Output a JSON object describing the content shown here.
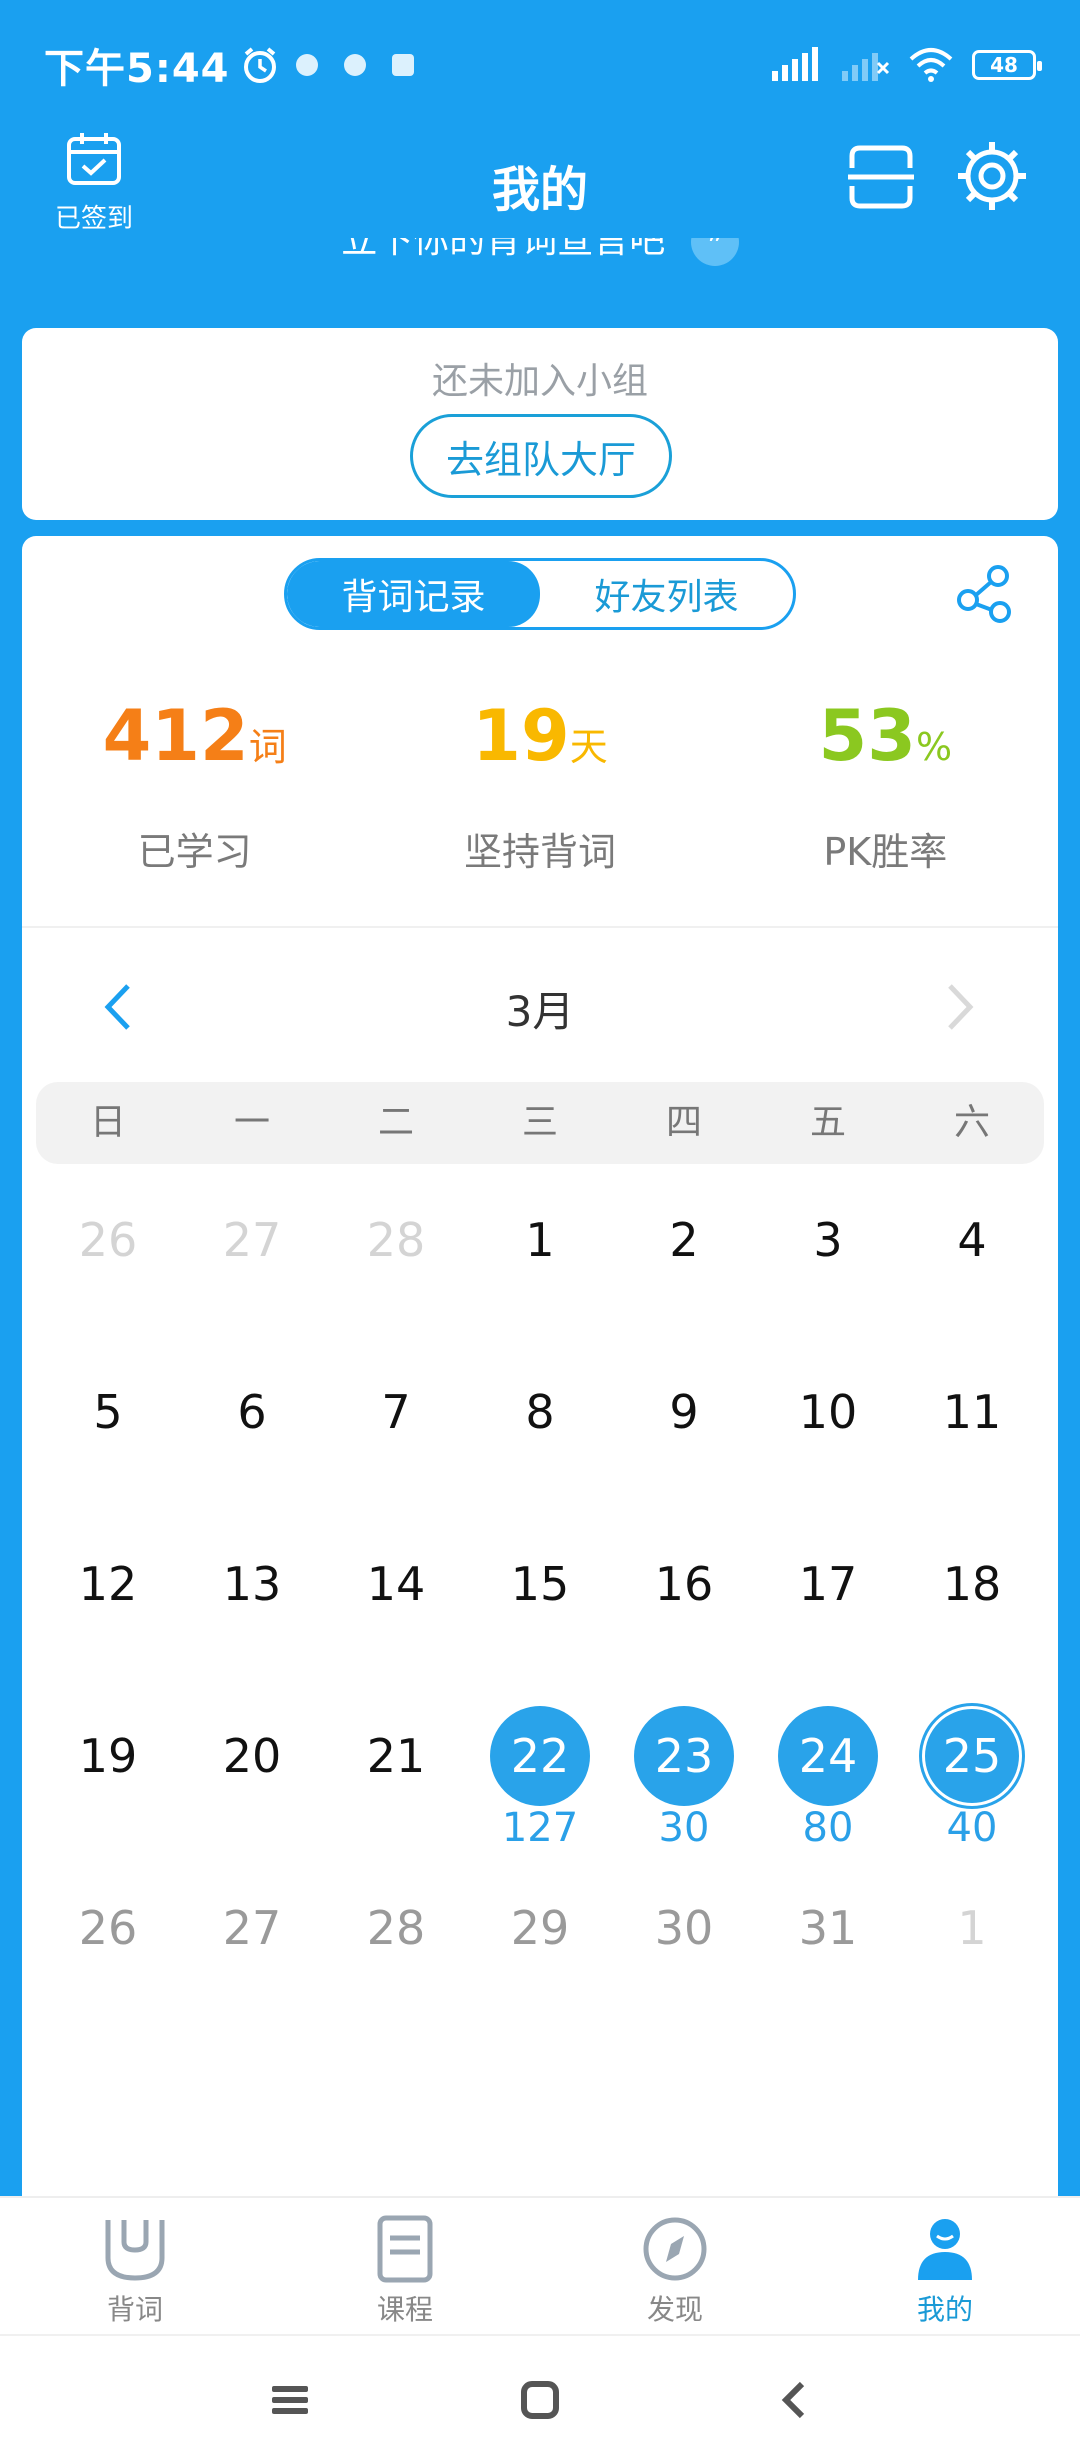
{
  "status_bar": {
    "time": "下午5:44",
    "battery": "48"
  },
  "header": {
    "title": "我的",
    "checkin_label": "已签到"
  },
  "slogan": "立下你的背词宣言吧",
  "group": {
    "status_text": "还未加入小组",
    "team_button": "去组队大厅"
  },
  "tabs": [
    {
      "label": "背词记录",
      "active": true
    },
    {
      "label": "好友列表",
      "active": false
    }
  ],
  "stats": [
    {
      "value": "412",
      "unit": "词",
      "label": "已学习",
      "color": "#f57f17"
    },
    {
      "value": "19",
      "unit": "天",
      "label": "坚持背词",
      "color": "#f9b800"
    },
    {
      "value": "53",
      "unit": "%",
      "label": "PK胜率",
      "color": "#8bc820"
    }
  ],
  "calendar": {
    "month": "3月",
    "weekdays": [
      "日",
      "一",
      "二",
      "三",
      "四",
      "五",
      "六"
    ],
    "weeks": [
      [
        {
          "d": "26",
          "s": "light"
        },
        {
          "d": "27",
          "s": "light"
        },
        {
          "d": "28",
          "s": "light"
        },
        {
          "d": "1"
        },
        {
          "d": "2"
        },
        {
          "d": "3"
        },
        {
          "d": "4"
        }
      ],
      [
        {
          "d": "5"
        },
        {
          "d": "6"
        },
        {
          "d": "7"
        },
        {
          "d": "8"
        },
        {
          "d": "9"
        },
        {
          "d": "10"
        },
        {
          "d": "11"
        }
      ],
      [
        {
          "d": "12"
        },
        {
          "d": "13"
        },
        {
          "d": "14"
        },
        {
          "d": "15"
        },
        {
          "d": "16"
        },
        {
          "d": "17"
        },
        {
          "d": "18"
        }
      ],
      [
        {
          "d": "19"
        },
        {
          "d": "20"
        },
        {
          "d": "21"
        },
        {
          "d": "22",
          "m": true,
          "c": "127"
        },
        {
          "d": "23",
          "m": true,
          "c": "30"
        },
        {
          "d": "24",
          "m": true,
          "c": "80"
        },
        {
          "d": "25",
          "m": true,
          "c": "40",
          "today": true
        }
      ],
      [
        {
          "d": "26",
          "s": "muted"
        },
        {
          "d": "27",
          "s": "muted"
        },
        {
          "d": "28",
          "s": "muted"
        },
        {
          "d": "29",
          "s": "muted"
        },
        {
          "d": "30",
          "s": "muted"
        },
        {
          "d": "31",
          "s": "muted"
        },
        {
          "d": "1",
          "s": "light"
        }
      ]
    ]
  },
  "bottom_nav": [
    {
      "label": "背词",
      "icon": "cup-icon",
      "active": false
    },
    {
      "label": "课程",
      "icon": "document-icon",
      "active": false
    },
    {
      "label": "发现",
      "icon": "compass-icon",
      "active": false
    },
    {
      "label": "我的",
      "icon": "user-icon",
      "active": true
    }
  ],
  "colors": {
    "brand": "#1aa0f0",
    "marked_day": "#29a3ea"
  }
}
